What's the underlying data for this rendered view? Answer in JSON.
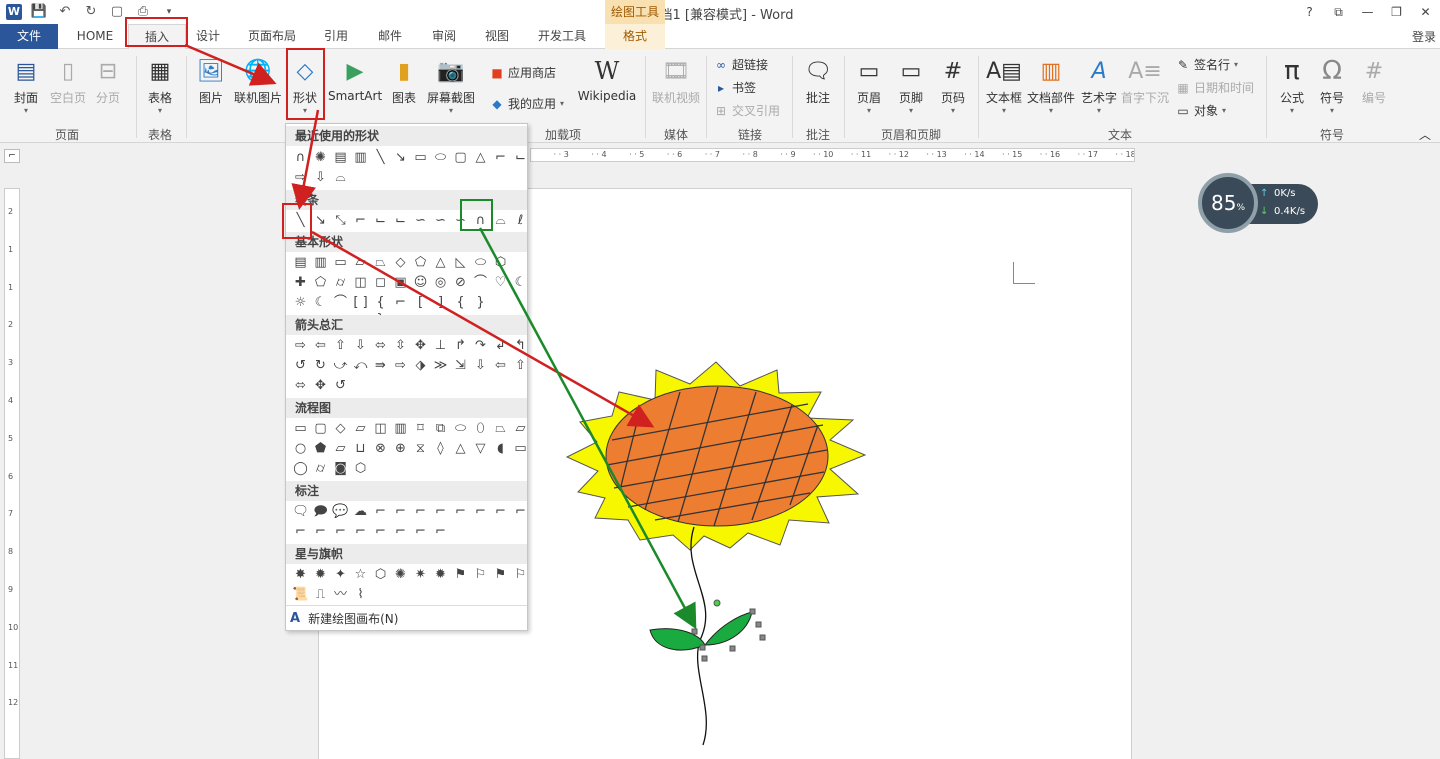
{
  "titlebar": {
    "doc_title": "文档1 [兼容模式] - Word",
    "tools_label": "绘图工具",
    "help": "?",
    "ribbon_display": "⧉",
    "minimize": "—",
    "restore": "❐",
    "close": "✕"
  },
  "tabs": {
    "file": "文件",
    "home": "HOME",
    "insert": "插入",
    "design": "设计",
    "layout": "页面布局",
    "references": "引用",
    "mailings": "邮件",
    "review": "审阅",
    "view": "视图",
    "developer": "开发工具",
    "format": "格式",
    "login": "登录"
  },
  "ribbon": {
    "cover": "封面",
    "blank_page": "空白页",
    "page_break": "分页",
    "table": "表格",
    "picture": "图片",
    "online_picture": "联机图片",
    "shapes": "形状",
    "smartart": "SmartArt",
    "chart": "图表",
    "screenshot": "屏幕截图",
    "app_store": "应用商店",
    "my_apps": "我的应用",
    "wikipedia": "Wikipedia",
    "online_video": "联机视频",
    "hyperlink": "超链接",
    "bookmark": "书签",
    "cross_ref": "交叉引用",
    "comment": "批注",
    "header": "页眉",
    "footer": "页脚",
    "page_number": "页码",
    "textbox": "文本框",
    "quick_parts": "文档部件",
    "wordart": "艺术字",
    "dropcap": "首字下沉",
    "signature": "签名行",
    "datetime": "日期和时间",
    "object": "对象",
    "equation": "公式",
    "symbol": "符号",
    "numbering": "编号",
    "groups": {
      "pages": "页面",
      "tables": "表格",
      "addins": "加载项",
      "media": "媒体",
      "links": "链接",
      "comments": "批注",
      "header_footer": "页眉和页脚",
      "text": "文本",
      "symbols": "符号"
    }
  },
  "shapes_menu": {
    "recent": "最近使用的形状",
    "lines": "线条",
    "basic": "基本形状",
    "arrows": "箭头总汇",
    "flowchart": "流程图",
    "callouts": "标注",
    "stars": "星与旗帜",
    "new_canvas": "新建绘图画布(N)"
  },
  "ruler": {
    "h_ticks": [
      "3",
      "4",
      "5",
      "6",
      "7",
      "8",
      "9",
      "10",
      "11",
      "12",
      "13",
      "14",
      "15",
      "16",
      "17",
      "18"
    ],
    "v_ticks": [
      "2",
      "1",
      "1",
      "2",
      "3",
      "4",
      "5",
      "6",
      "7",
      "8",
      "9",
      "10",
      "11",
      "12"
    ]
  },
  "net_widget": {
    "percent": "85",
    "percent_sign": "%",
    "up": "0K/s",
    "down": "0.4K/s"
  },
  "colors": {
    "accent": "#2b579a",
    "petal": "#f7f700",
    "head": "#ed7d31",
    "leaf": "#1aab40",
    "red_marker": "#d02020",
    "green_marker": "#1a8a2a"
  }
}
